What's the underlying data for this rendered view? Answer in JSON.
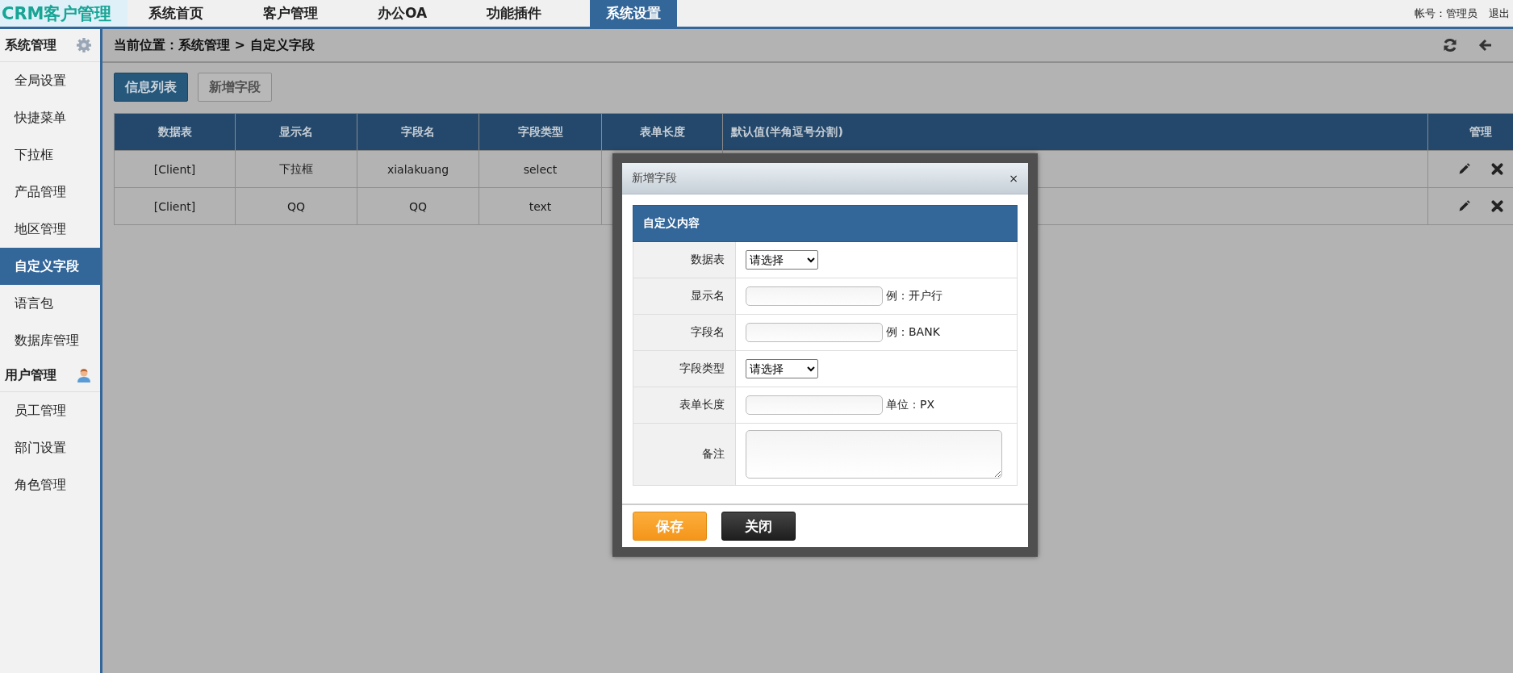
{
  "header": {
    "logo": "CRM客户管理",
    "nav": [
      {
        "label": "系统首页",
        "selected": false
      },
      {
        "label": "客户管理",
        "selected": false
      },
      {
        "label": "办公OA",
        "selected": false
      },
      {
        "label": "功能插件",
        "selected": false
      },
      {
        "label": "系统设置",
        "selected": true
      }
    ],
    "account": "帐号：管理员",
    "logout": "退出"
  },
  "sidebar": {
    "sections": [
      {
        "title": "系统管理",
        "items": [
          {
            "label": "全局设置",
            "selected": false
          },
          {
            "label": "快捷菜单",
            "selected": false
          },
          {
            "label": "下拉框",
            "selected": false
          },
          {
            "label": "产品管理",
            "selected": false
          },
          {
            "label": "地区管理",
            "selected": false
          },
          {
            "label": "自定义字段",
            "selected": true
          },
          {
            "label": "语言包",
            "selected": false
          },
          {
            "label": "数据库管理",
            "selected": false
          }
        ]
      },
      {
        "title": "用户管理",
        "items": [
          {
            "label": "员工管理",
            "selected": false
          },
          {
            "label": "部门设置",
            "selected": false
          },
          {
            "label": "角色管理",
            "selected": false
          }
        ]
      }
    ]
  },
  "breadcrumb": "当前位置：系统管理 > 自定义字段",
  "tabs": [
    {
      "label": "信息列表",
      "selected": true
    },
    {
      "label": "新增字段",
      "selected": false
    }
  ],
  "table": {
    "columns": [
      "数据表",
      "显示名",
      "字段名",
      "字段类型",
      "表单长度",
      "默认值(半角逗号分割)",
      "管理"
    ],
    "rows": [
      {
        "cells": [
          "[Client]",
          "下拉框",
          "xialakuang",
          "select"
        ]
      },
      {
        "cells": [
          "[Client]",
          "QQ",
          "QQ",
          "text"
        ]
      }
    ]
  },
  "dialog": {
    "title": "新增字段",
    "close": "×",
    "section_title": "自定义内容",
    "fields": [
      {
        "label": "数据表",
        "kind": "select",
        "value": "请选择"
      },
      {
        "label": "显示名",
        "kind": "input",
        "note": "例：开户行"
      },
      {
        "label": "字段名",
        "kind": "input",
        "note": "例：BANK"
      },
      {
        "label": "字段类型",
        "kind": "select",
        "value": "请选择"
      },
      {
        "label": "表单长度",
        "kind": "input",
        "note": "单位：PX"
      },
      {
        "label": "备注",
        "kind": "textarea"
      }
    ],
    "buttons": [
      {
        "label": "保存",
        "kind": "primary"
      },
      {
        "label": "关闭",
        "kind": "dark"
      }
    ]
  }
}
